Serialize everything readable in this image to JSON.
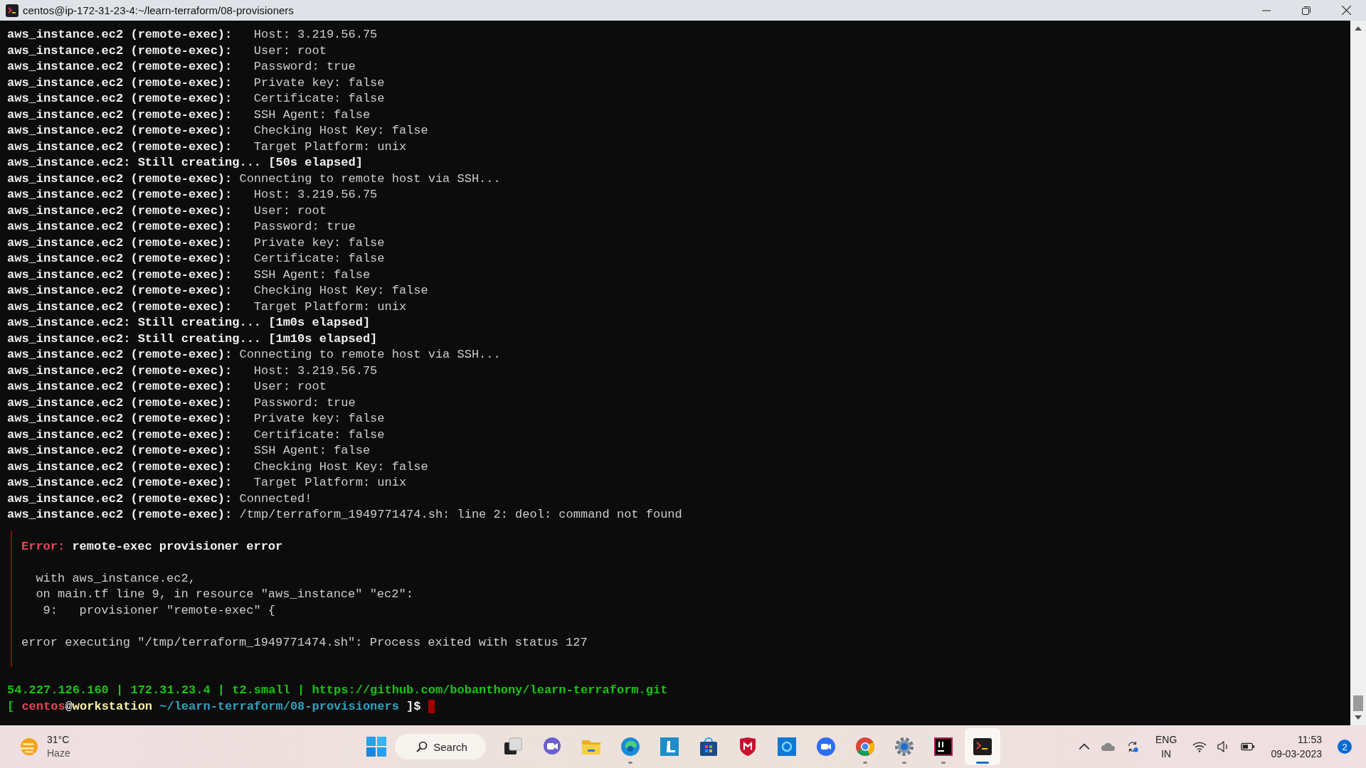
{
  "window": {
    "title": "centos@ip-172-31-23-4:~/learn-terraform/08-provisioners"
  },
  "terminal": {
    "lines": [
      {
        "kind": "detail",
        "source": "aws_instance.ec2 (remote-exec):",
        "text": "Host: 3.219.56.75"
      },
      {
        "kind": "detail",
        "source": "aws_instance.ec2 (remote-exec):",
        "text": "User: root"
      },
      {
        "kind": "detail",
        "source": "aws_instance.ec2 (remote-exec):",
        "text": "Password: true"
      },
      {
        "kind": "detail",
        "source": "aws_instance.ec2 (remote-exec):",
        "text": "Private key: false"
      },
      {
        "kind": "detail",
        "source": "aws_instance.ec2 (remote-exec):",
        "text": "Certificate: false"
      },
      {
        "kind": "detail",
        "source": "aws_instance.ec2 (remote-exec):",
        "text": "SSH Agent: false"
      },
      {
        "kind": "detail",
        "source": "aws_instance.ec2 (remote-exec):",
        "text": "Checking Host Key: false"
      },
      {
        "kind": "detail",
        "source": "aws_instance.ec2 (remote-exec):",
        "text": "Target Platform: unix"
      },
      {
        "kind": "status",
        "text": "aws_instance.ec2: Still creating... [50s elapsed]"
      },
      {
        "kind": "message",
        "source": "aws_instance.ec2 (remote-exec):",
        "text": "Connecting to remote host via SSH..."
      },
      {
        "kind": "detail",
        "source": "aws_instance.ec2 (remote-exec):",
        "text": "Host: 3.219.56.75"
      },
      {
        "kind": "detail",
        "source": "aws_instance.ec2 (remote-exec):",
        "text": "User: root"
      },
      {
        "kind": "detail",
        "source": "aws_instance.ec2 (remote-exec):",
        "text": "Password: true"
      },
      {
        "kind": "detail",
        "source": "aws_instance.ec2 (remote-exec):",
        "text": "Private key: false"
      },
      {
        "kind": "detail",
        "source": "aws_instance.ec2 (remote-exec):",
        "text": "Certificate: false"
      },
      {
        "kind": "detail",
        "source": "aws_instance.ec2 (remote-exec):",
        "text": "SSH Agent: false"
      },
      {
        "kind": "detail",
        "source": "aws_instance.ec2 (remote-exec):",
        "text": "Checking Host Key: false"
      },
      {
        "kind": "detail",
        "source": "aws_instance.ec2 (remote-exec):",
        "text": "Target Platform: unix"
      },
      {
        "kind": "status",
        "text": "aws_instance.ec2: Still creating... [1m0s elapsed]"
      },
      {
        "kind": "status",
        "text": "aws_instance.ec2: Still creating... [1m10s elapsed]"
      },
      {
        "kind": "message",
        "source": "aws_instance.ec2 (remote-exec):",
        "text": "Connecting to remote host via SSH..."
      },
      {
        "kind": "detail",
        "source": "aws_instance.ec2 (remote-exec):",
        "text": "Host: 3.219.56.75"
      },
      {
        "kind": "detail",
        "source": "aws_instance.ec2 (remote-exec):",
        "text": "User: root"
      },
      {
        "kind": "detail",
        "source": "aws_instance.ec2 (remote-exec):",
        "text": "Password: true"
      },
      {
        "kind": "detail",
        "source": "aws_instance.ec2 (remote-exec):",
        "text": "Private key: false"
      },
      {
        "kind": "detail",
        "source": "aws_instance.ec2 (remote-exec):",
        "text": "Certificate: false"
      },
      {
        "kind": "detail",
        "source": "aws_instance.ec2 (remote-exec):",
        "text": "SSH Agent: false"
      },
      {
        "kind": "detail",
        "source": "aws_instance.ec2 (remote-exec):",
        "text": "Checking Host Key: false"
      },
      {
        "kind": "detail",
        "source": "aws_instance.ec2 (remote-exec):",
        "text": "Target Platform: unix"
      },
      {
        "kind": "message",
        "source": "aws_instance.ec2 (remote-exec):",
        "text": "Connected!"
      },
      {
        "kind": "message",
        "source": "aws_instance.ec2 (remote-exec):",
        "text": "/tmp/terraform_1949771474.sh: line 2: deol: command not found"
      }
    ],
    "error": {
      "label": "Error:",
      "title": "remote-exec provisioner error",
      "context": [
        {
          "kind": "scope",
          "text": "with aws_instance.ec2,"
        },
        {
          "kind": "scope",
          "text": "on main.tf line 9, in resource \"aws_instance\" \"ec2\":"
        },
        {
          "kind": "source",
          "text": "9:   provisioner \"remote-exec\" {"
        }
      ],
      "message": "error executing \"/tmp/terraform_1949771474.sh\": Process exited with status 127"
    },
    "status_line": "54.227.126.160 | 172.31.23.4 | t2.small | https://github.com/bobanthony/learn-terraform.git",
    "prompt": {
      "open": "[",
      "user": "centos",
      "at": "@",
      "host": "workstation",
      "path": "~/learn-terraform/08-provisioners",
      "close": "]$"
    }
  },
  "taskbar": {
    "weather": {
      "temperature": "31°C",
      "condition": "Haze"
    },
    "search": {
      "label": "Search"
    },
    "apps": [
      {
        "kind": "task-view",
        "running": false,
        "selected": false
      },
      {
        "kind": "meet",
        "running": false,
        "selected": false
      },
      {
        "kind": "files",
        "running": false,
        "selected": false
      },
      {
        "kind": "edge",
        "running": true,
        "selected": false
      },
      {
        "kind": "l-app",
        "running": false,
        "selected": false
      },
      {
        "kind": "store",
        "running": false,
        "selected": false
      },
      {
        "kind": "shield",
        "running": false,
        "selected": false
      },
      {
        "kind": "ring",
        "running": false,
        "selected": false
      },
      {
        "kind": "zoom",
        "running": false,
        "selected": false
      },
      {
        "kind": "chrome",
        "running": true,
        "selected": false
      },
      {
        "kind": "settings",
        "running": true,
        "selected": false
      },
      {
        "kind": "ide",
        "running": true,
        "selected": false
      },
      {
        "kind": "terminal",
        "running": true,
        "selected": true
      }
    ],
    "tray": {
      "language": "ENG",
      "region": "IN",
      "time": "11:53",
      "date": "09-03-2023",
      "notifications": "2"
    }
  }
}
